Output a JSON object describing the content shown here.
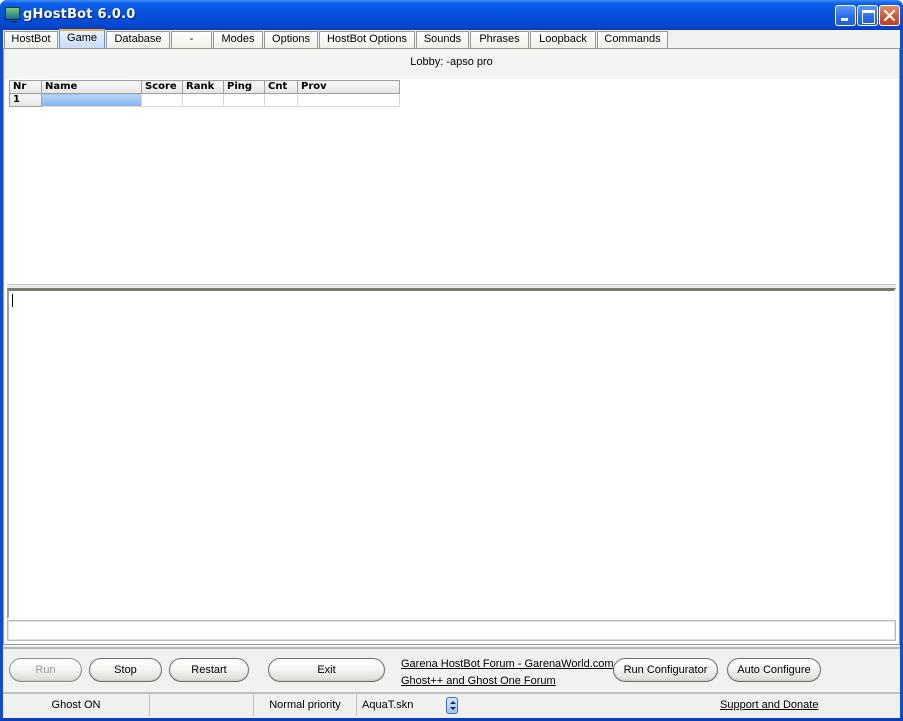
{
  "window": {
    "title": "gHostBot  6.0.0",
    "controls": [
      "minimize",
      "maximize",
      "close"
    ]
  },
  "tabs": [
    {
      "label": "HostBot",
      "active": false
    },
    {
      "label": "Game",
      "active": true
    },
    {
      "label": "Database",
      "active": false
    },
    {
      "label": "-",
      "active": false
    },
    {
      "label": "Modes",
      "active": false
    },
    {
      "label": "Options",
      "active": false
    },
    {
      "label": "HostBot Options",
      "active": false
    },
    {
      "label": "Sounds",
      "active": false
    },
    {
      "label": "Phrases",
      "active": false
    },
    {
      "label": "Loopback",
      "active": false
    },
    {
      "label": "Commands",
      "active": false
    }
  ],
  "game": {
    "lobby_label": "Lobby: -apso pro",
    "players_table": {
      "columns": [
        "Nr",
        "Name",
        "Score",
        "Rank",
        "Ping",
        "Cnt",
        "Prov"
      ],
      "rows": [
        {
          "nr": "1",
          "name": "",
          "score": "",
          "rank": "",
          "ping": "",
          "cnt": "",
          "prov": "",
          "selected_cell": "name"
        }
      ]
    },
    "log_text": "",
    "command_input": ""
  },
  "buttons": {
    "run": {
      "label": "Run",
      "enabled": false
    },
    "stop": {
      "label": "Stop",
      "enabled": true
    },
    "restart": {
      "label": "Restart",
      "enabled": true
    },
    "exit": {
      "label": "Exit",
      "enabled": true
    },
    "run_configurator": {
      "label": "Run Configurator",
      "enabled": true
    },
    "auto_configure": {
      "label": "Auto Configure",
      "enabled": true
    }
  },
  "links": {
    "garena_forum": "Garena HostBot Forum - GarenaWorld.com",
    "ghost_forum": "Ghost++ and Ghost One Forum",
    "support": "Support and Donate"
  },
  "statusbar": {
    "ghost_status": "Ghost ON",
    "empty_cell": "",
    "priority": "Normal priority",
    "skin": "AquaT.skn"
  }
}
